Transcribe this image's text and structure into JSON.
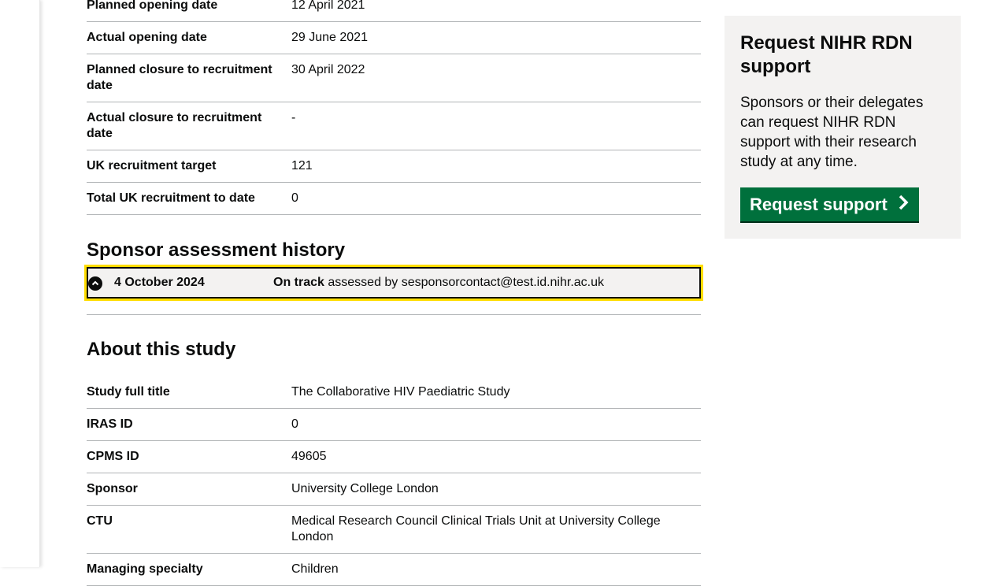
{
  "key_dates": [
    {
      "label": "Planned opening date",
      "value": "12 April 2021"
    },
    {
      "label": "Actual opening date",
      "value": "29 June 2021"
    },
    {
      "label": "Planned closure to recruitment date",
      "value": "30 April 2022"
    },
    {
      "label": "Actual closure to recruitment date",
      "value": "-"
    },
    {
      "label": "UK recruitment target",
      "value": "121"
    },
    {
      "label": "Total UK recruitment to date",
      "value": "0"
    }
  ],
  "sponsor_history": {
    "heading": "Sponsor assessment history",
    "entry": {
      "date": "4 October 2024",
      "status": "On track",
      "assessed_text": " assessed by sesponsorcontact@test.id.nihr.ac.uk"
    }
  },
  "about": {
    "heading": "About this study",
    "rows": [
      {
        "label": "Study full title",
        "value": "The Collaborative HIV Paediatric Study"
      },
      {
        "label": "IRAS ID",
        "value": "0"
      },
      {
        "label": "CPMS ID",
        "value": "49605"
      },
      {
        "label": "Sponsor",
        "value": "University College London"
      },
      {
        "label": "CTU",
        "value": "Medical Research Council Clinical Trials Unit at University College London"
      },
      {
        "label": "Managing specialty",
        "value": "Children"
      }
    ]
  },
  "sidebar": {
    "title": "Request NIHR RDN support",
    "body": "Sponsors or their delegates can request NIHR RDN support with their research study at any time.",
    "button_label": "Request support"
  },
  "colors": {
    "button_green": "#00703c",
    "focus_yellow": "#ffdd00",
    "panel_grey": "#f3f2f1"
  }
}
